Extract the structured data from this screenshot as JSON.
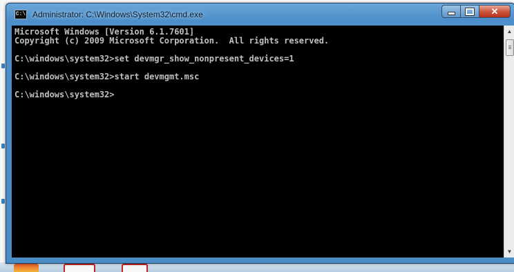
{
  "window": {
    "title": "Administrator: C:\\Windows\\System32\\cmd.exe",
    "icon_label": "C:\\",
    "buttons": {
      "minimize": "minimize-icon",
      "maximize": "maximize-icon",
      "close": "✕"
    }
  },
  "console": {
    "lines": [
      "Microsoft Windows [Version 6.1.7601]",
      "Copyright (c) 2009 Microsoft Corporation.  All rights reserved.",
      "",
      "C:\\windows\\system32>set devmgr_show_nonpresent_devices=1",
      "",
      "C:\\windows\\system32>start devmgmt.msc",
      "",
      "C:\\windows\\system32>"
    ]
  },
  "scrollbar": {
    "up": "▲",
    "down": "▼"
  },
  "colors": {
    "frame": "#4d8fca",
    "console_bg": "#000000",
    "console_text": "#c0c0c0",
    "close_button": "#c7533a"
  }
}
